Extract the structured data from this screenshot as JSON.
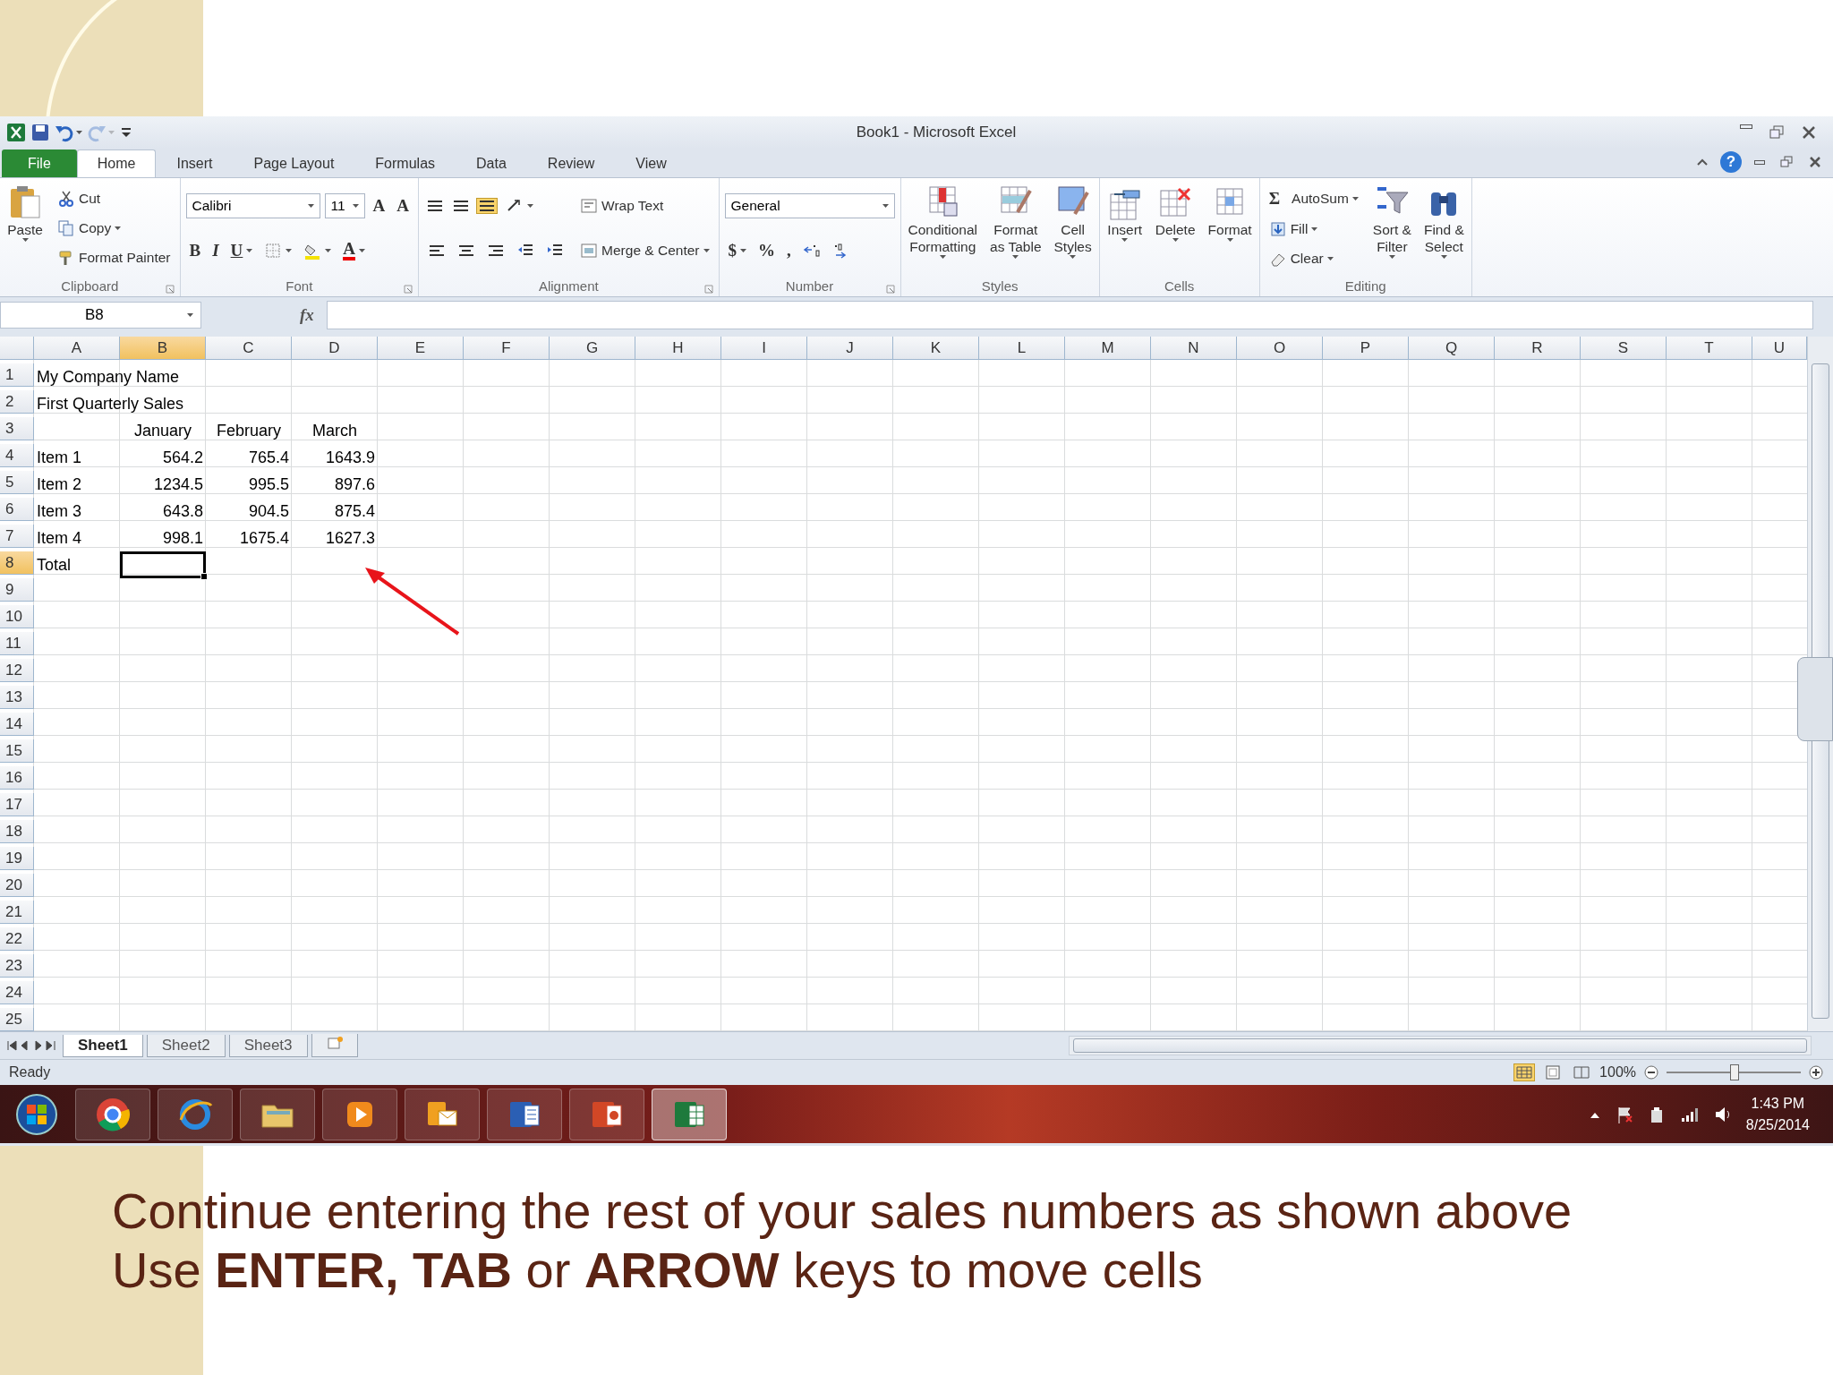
{
  "window": {
    "title": "Book1  -  Microsoft Excel"
  },
  "quick_access": [
    {
      "kind": "logo"
    },
    {
      "kind": "save"
    },
    {
      "kind": "undo",
      "dropdown": true
    },
    {
      "kind": "redo",
      "dropdown": true,
      "disabled": true
    },
    {
      "kind": "customize"
    }
  ],
  "tabs": [
    {
      "label": "File",
      "kind": "file",
      "selected": false
    },
    {
      "label": "Home",
      "kind": "tab",
      "selected": true
    },
    {
      "label": "Insert",
      "kind": "tab",
      "selected": false
    },
    {
      "label": "Page Layout",
      "kind": "tab",
      "selected": false
    },
    {
      "label": "Formulas",
      "kind": "tab",
      "selected": false
    },
    {
      "label": "Data",
      "kind": "tab",
      "selected": false
    },
    {
      "label": "Review",
      "kind": "tab",
      "selected": false
    },
    {
      "label": "View",
      "kind": "tab",
      "selected": false
    }
  ],
  "help_label": "?",
  "ribbon": [
    {
      "name": "Clipboard",
      "launcher": true,
      "blocks": [
        {
          "kind": "large",
          "lines": [
            "Paste"
          ],
          "dropdown": true
        },
        {
          "kind": "stack",
          "rows": [
            {
              "items": [
                {
                  "kind": "button",
                  "label": "Cut"
                }
              ]
            },
            {
              "items": [
                {
                  "kind": "button",
                  "label": "Copy",
                  "dropdown": true
                }
              ]
            },
            {
              "items": [
                {
                  "kind": "button",
                  "label": "Format Painter"
                }
              ]
            }
          ]
        }
      ]
    },
    {
      "name": "Font",
      "launcher": true,
      "blocks": [
        {
          "kind": "stack",
          "rows": [
            {
              "items": [
                {
                  "kind": "field",
                  "value": "Calibri"
                },
                {
                  "kind": "field",
                  "value": "11"
                },
                {
                  "kind": "glyph",
                  "label": "A"
                },
                {
                  "kind": "glyph",
                  "label": "A"
                }
              ]
            },
            {
              "items": [
                {
                  "kind": "glyph",
                  "label": "B"
                },
                {
                  "kind": "glyph",
                  "label": "I"
                },
                {
                  "kind": "glyph",
                  "label": "U",
                  "dropdown": true
                },
                {
                  "kind": "button",
                  "dropdown": true
                },
                {
                  "kind": "button",
                  "dropdown": true
                },
                {
                  "kind": "glyph",
                  "label": "A",
                  "dropdown": true
                }
              ]
            }
          ]
        }
      ]
    },
    {
      "name": "Alignment",
      "launcher": true,
      "blocks": [
        {
          "kind": "stack",
          "rows": [
            {
              "items": [
                {
                  "kind": "button",
                  "selected": false
                },
                {
                  "kind": "button",
                  "selected": false
                },
                {
                  "kind": "button",
                  "selected": true
                },
                {
                  "kind": "button",
                  "dropdown": true
                }
              ]
            },
            {
              "items": [
                {
                  "kind": "button",
                  "selected": false
                },
                {
                  "kind": "button",
                  "selected": false
                },
                {
                  "kind": "button",
                  "selected": false
                },
                {
                  "kind": "button"
                },
                {
                  "kind": "button"
                }
              ]
            }
          ]
        },
        {
          "kind": "stack",
          "rows": [
            {
              "items": [
                {
                  "kind": "button",
                  "label": "Wrap Text"
                }
              ]
            },
            {
              "items": [
                {
                  "kind": "button",
                  "label": "Merge & Center",
                  "dropdown": true
                }
              ]
            }
          ]
        }
      ]
    },
    {
      "name": "Number",
      "launcher": true,
      "blocks": [
        {
          "kind": "stack",
          "rows": [
            {
              "items": [
                {
                  "kind": "field",
                  "value": "General"
                }
              ]
            },
            {
              "items": [
                {
                  "kind": "glyph",
                  "label": "$",
                  "dropdown": true
                },
                {
                  "kind": "glyph",
                  "label": "%"
                },
                {
                  "kind": "glyph",
                  "label": ","
                },
                {
                  "kind": "button"
                },
                {
                  "kind": "button"
                }
              ]
            }
          ]
        }
      ]
    },
    {
      "name": "Styles",
      "launcher": false,
      "blocks": [
        {
          "kind": "large",
          "lines": [
            "Conditional",
            "Formatting"
          ],
          "dropdown": true
        },
        {
          "kind": "large",
          "lines": [
            "Format",
            "as Table"
          ],
          "dropdown": true
        },
        {
          "kind": "large",
          "lines": [
            "Cell",
            "Styles"
          ],
          "dropdown": true
        }
      ]
    },
    {
      "name": "Cells",
      "launcher": false,
      "blocks": [
        {
          "kind": "large",
          "lines": [
            "Insert"
          ],
          "dropdown": true
        },
        {
          "kind": "large",
          "lines": [
            "Delete"
          ],
          "dropdown": true
        },
        {
          "kind": "large",
          "lines": [
            "Format"
          ],
          "dropdown": true
        }
      ]
    },
    {
      "name": "Editing",
      "launcher": false,
      "blocks": [
        {
          "kind": "stack",
          "rows": [
            {
              "items": [
                {
                  "kind": "glyph",
                  "label": "Σ"
                },
                {
                  "kind": "text",
                  "label": "AutoSum",
                  "dropdown": true
                }
              ]
            },
            {
              "items": [
                {
                  "kind": "button",
                  "label": "Fill",
                  "dropdown": true
                }
              ]
            },
            {
              "items": [
                {
                  "kind": "button",
                  "label": "Clear",
                  "dropdown": true
                }
              ]
            }
          ]
        },
        {
          "kind": "large",
          "lines": [
            "Sort &",
            "Filter"
          ],
          "dropdown": true
        },
        {
          "kind": "large",
          "lines": [
            "Find &",
            "Select"
          ],
          "dropdown": true
        }
      ]
    }
  ],
  "formula_bar": {
    "name_box": "B8",
    "function_label": "fx"
  },
  "columns": [
    {
      "label": "A",
      "selected": false
    },
    {
      "label": "B",
      "selected": true
    },
    {
      "label": "C",
      "selected": false
    },
    {
      "label": "D",
      "selected": false
    },
    {
      "label": "E",
      "selected": false
    },
    {
      "label": "F",
      "selected": false
    },
    {
      "label": "G",
      "selected": false
    },
    {
      "label": "H",
      "selected": false
    },
    {
      "label": "I",
      "selected": false
    },
    {
      "label": "J",
      "selected": false
    },
    {
      "label": "K",
      "selected": false
    },
    {
      "label": "L",
      "selected": false
    },
    {
      "label": "M",
      "selected": false
    },
    {
      "label": "N",
      "selected": false
    },
    {
      "label": "O",
      "selected": false
    },
    {
      "label": "P",
      "selected": false
    },
    {
      "label": "Q",
      "selected": false
    },
    {
      "label": "R",
      "selected": false
    },
    {
      "label": "S",
      "selected": false
    },
    {
      "label": "T",
      "selected": false
    },
    {
      "label": "U",
      "selected": false
    }
  ],
  "rows": [
    {
      "label": "1",
      "selected": false,
      "cells": [
        {
          "kind": "text",
          "text": "My Company Name"
        }
      ]
    },
    {
      "label": "2",
      "selected": false,
      "cells": [
        {
          "kind": "text",
          "text": "First Quarterly Sales"
        }
      ]
    },
    {
      "label": "3",
      "selected": false,
      "cells": [
        {
          "kind": "empty"
        },
        {
          "kind": "heading",
          "text": "January"
        },
        {
          "kind": "heading",
          "text": "February"
        },
        {
          "kind": "heading",
          "text": "March"
        }
      ]
    },
    {
      "label": "4",
      "selected": false,
      "cells": [
        {
          "kind": "text",
          "text": "Item 1"
        },
        {
          "kind": "number",
          "text": "564.2"
        },
        {
          "kind": "number",
          "text": "765.4"
        },
        {
          "kind": "number",
          "text": "1643.9"
        }
      ]
    },
    {
      "label": "5",
      "selected": false,
      "cells": [
        {
          "kind": "text",
          "text": "Item 2"
        },
        {
          "kind": "number",
          "text": "1234.5"
        },
        {
          "kind": "number",
          "text": "995.5"
        },
        {
          "kind": "number",
          "text": "897.6"
        }
      ]
    },
    {
      "label": "6",
      "selected": false,
      "cells": [
        {
          "kind": "text",
          "text": "Item 3"
        },
        {
          "kind": "number",
          "text": "643.8"
        },
        {
          "kind": "number",
          "text": "904.5"
        },
        {
          "kind": "number",
          "text": "875.4"
        }
      ]
    },
    {
      "label": "7",
      "selected": false,
      "cells": [
        {
          "kind": "text",
          "text": "Item 4"
        },
        {
          "kind": "number",
          "text": "998.1"
        },
        {
          "kind": "number",
          "text": "1675.4"
        },
        {
          "kind": "number",
          "text": "1627.3"
        }
      ]
    },
    {
      "label": "8",
      "selected": true,
      "cells": [
        {
          "kind": "text",
          "text": "Total",
          "selected": false
        },
        {
          "kind": "empty",
          "selected": true
        }
      ]
    },
    {
      "label": "9",
      "selected": false
    },
    {
      "label": "10",
      "selected": false
    },
    {
      "label": "11",
      "selected": false
    },
    {
      "label": "12",
      "selected": false
    },
    {
      "label": "13",
      "selected": false
    },
    {
      "label": "14",
      "selected": false
    },
    {
      "label": "15",
      "selected": false
    },
    {
      "label": "16",
      "selected": false
    },
    {
      "label": "17",
      "selected": false
    },
    {
      "label": "18",
      "selected": false
    },
    {
      "label": "19",
      "selected": false
    },
    {
      "label": "20",
      "selected": false
    },
    {
      "label": "21",
      "selected": false
    },
    {
      "label": "22",
      "selected": false
    },
    {
      "label": "23",
      "selected": false
    },
    {
      "label": "24",
      "selected": false
    },
    {
      "label": "25",
      "selected": false
    }
  ],
  "sheet_tabs": [
    {
      "label": "Sheet1",
      "selected": true
    },
    {
      "label": "Sheet2",
      "selected": false
    },
    {
      "label": "Sheet3",
      "selected": false
    }
  ],
  "status_bar": {
    "status": "Ready",
    "zoom": "100%",
    "zoom_slider": {
      "level": 0.5
    },
    "views": [
      {
        "selected": true
      },
      {
        "selected": false
      },
      {
        "selected": false
      }
    ]
  },
  "taskbar": {
    "apps": [
      {
        "selected": false
      },
      {
        "selected": false
      },
      {
        "selected": false
      },
      {
        "selected": false
      },
      {
        "selected": false
      },
      {
        "selected": false
      },
      {
        "selected": false
      },
      {
        "selected": true
      }
    ],
    "time": "1:43 PM",
    "date": "8/25/2014"
  },
  "caption": [
    "Continue entering the rest of your sales numbers as shown above",
    "Use **ENTER, TAB** or **ARROW** keys to move cells"
  ]
}
